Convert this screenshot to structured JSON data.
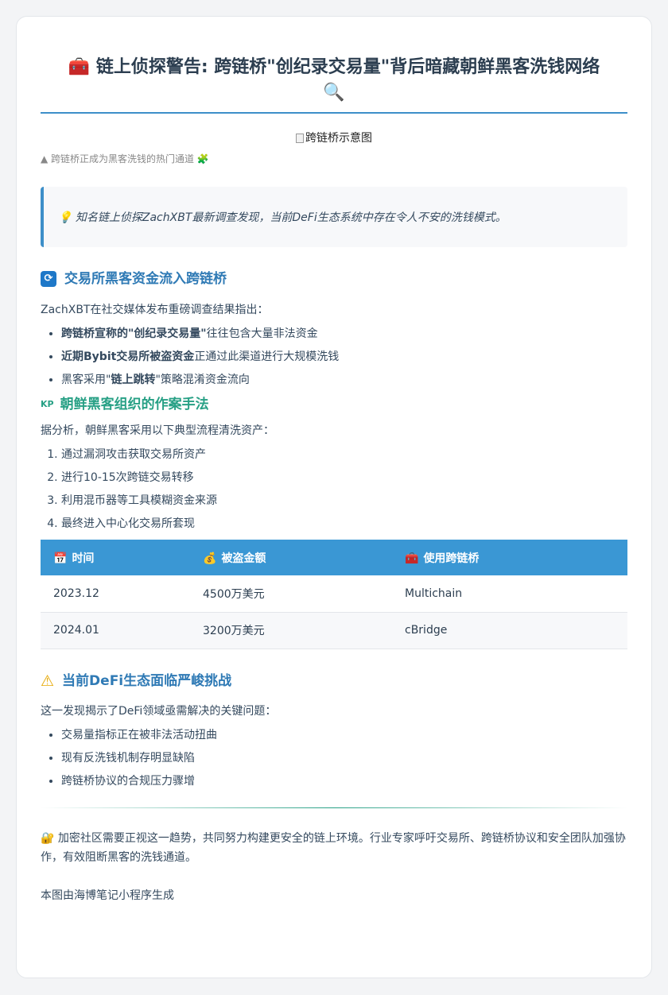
{
  "title": {
    "icon": "toolbox-icon",
    "text": "链上侦探警告: 跨链桥\"创纪录交易量\"背后暗藏朝鲜黑客洗钱网络",
    "trail_icon": "magnifier-icon"
  },
  "image_alt": "跨链桥示意图",
  "caption": "▲ 跨链桥正成为黑客洗钱的热门通道 🧩",
  "callout": "💡 知名链上侦探ZachXBT最新调查发现，当前DeFi生态系统中存在令人不安的洗钱模式。",
  "section1": {
    "icon": "refresh-icon",
    "heading": "交易所黑客资金流入跨链桥",
    "intro": "ZachXBT在社交媒体发布重磅调查结果指出：",
    "bullets": [
      {
        "bold": "跨链桥宣称的\"创纪录交易量\"",
        "rest": "往往包含大量非法资金"
      },
      {
        "bold": "近期Bybit交易所被盗资金",
        "rest": "正通过此渠道进行大规模洗钱"
      },
      {
        "pre": "黑客采用\"",
        "bold": "链上跳转",
        "rest": "\"策略混淆资金流向"
      }
    ]
  },
  "section2": {
    "icon_text": "KP",
    "heading": "朝鲜黑客组织的作案手法",
    "intro": "据分析，朝鲜黑客采用以下典型流程清洗资产：",
    "steps": [
      "通过漏洞攻击获取交易所资产",
      "进行10-15次跨链交易转移",
      "利用混币器等工具模糊资金来源",
      "最终进入中心化交易所套现"
    ]
  },
  "table": {
    "headers": [
      {
        "icon": "📅",
        "label": "时间"
      },
      {
        "icon": "💰",
        "label": "被盗金额"
      },
      {
        "icon": "🧰",
        "label": "使用跨链桥"
      }
    ],
    "rows": [
      [
        "2023.12",
        "4500万美元",
        "Multichain"
      ],
      [
        "2024.01",
        "3200万美元",
        "cBridge"
      ]
    ]
  },
  "section3": {
    "icon": "warning-icon",
    "heading": "当前DeFi生态面临严峻挑战",
    "intro": "这一发现揭示了DeFi领域亟需解决的关键问题：",
    "bullets": [
      "交易量指标正在被非法活动扭曲",
      "现有反洗钱机制存明显缺陷",
      "跨链桥协议的合规压力骤增"
    ]
  },
  "closing": "🔐 加密社区需要正视这一趋势，共同努力构建更安全的链上环境。行业专家呼吁交易所、跨链桥协议和安全团队加强协作，有效阻断黑客的洗钱通道。",
  "footer": "本图由海博笔记小程序生成",
  "colors": {
    "accent": "#3d8fc9",
    "heading_blue": "#2f7ab5",
    "heading_green": "#27a085",
    "table_header": "#3a97d4"
  }
}
